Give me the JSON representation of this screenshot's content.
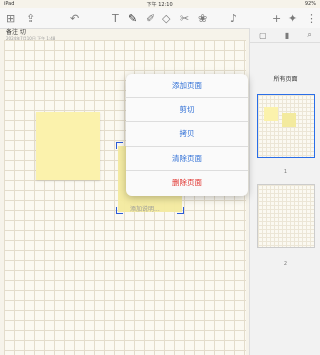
{
  "status": {
    "device": "iPad",
    "time": "下午 12:10",
    "battery": "92%"
  },
  "toolbar": {
    "icons": [
      "grid-icon",
      "share-icon",
      "undo-icon",
      "text-tool-icon",
      "pen-icon",
      "highlighter-icon",
      "eraser-icon",
      "lasso-icon",
      "image-icon",
      "mic-icon",
      "add-icon",
      "wrench-icon",
      "more-icon"
    ]
  },
  "document": {
    "title": "备注 切",
    "subtitle": "2024年7月10日 下午 1:48"
  },
  "selection": {
    "caption": "添加说明..."
  },
  "context_menu": {
    "items": [
      "添加页面",
      "剪切",
      "拷贝",
      "清除页面",
      "删除页面"
    ]
  },
  "sidebar": {
    "title": "所有页面",
    "thumbnails": [
      {
        "number": "1"
      },
      {
        "number": "2"
      }
    ]
  },
  "colors": {
    "accent": "#2f6fd6",
    "danger": "#e0322d",
    "sticky": "#fbf2ac"
  }
}
